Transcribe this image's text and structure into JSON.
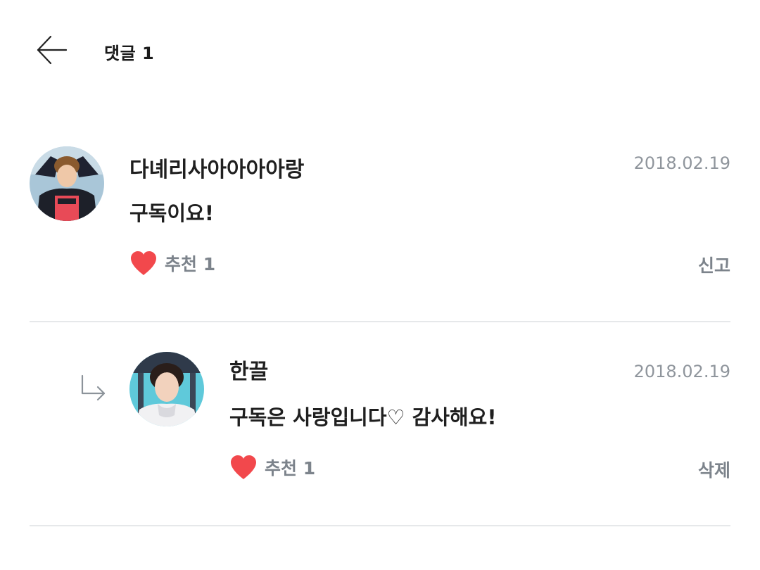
{
  "header": {
    "title": "댓글 1"
  },
  "comments": [
    {
      "author": "다녜리사아아아아랑",
      "date": "2018.02.19",
      "text": "구독이요!",
      "like_label": "추천 1",
      "action_label": "신고"
    }
  ],
  "replies": [
    {
      "author": "한끌",
      "date": "2018.02.19",
      "text": "구독은 사랑입니다♡ 감사해요!",
      "like_label": "추천 1",
      "action_label": "삭제"
    }
  ],
  "colors": {
    "heart": "#f2484c",
    "muted_text": "#7c838b",
    "date_text": "#8f959c",
    "divider": "#e6e8ea"
  }
}
